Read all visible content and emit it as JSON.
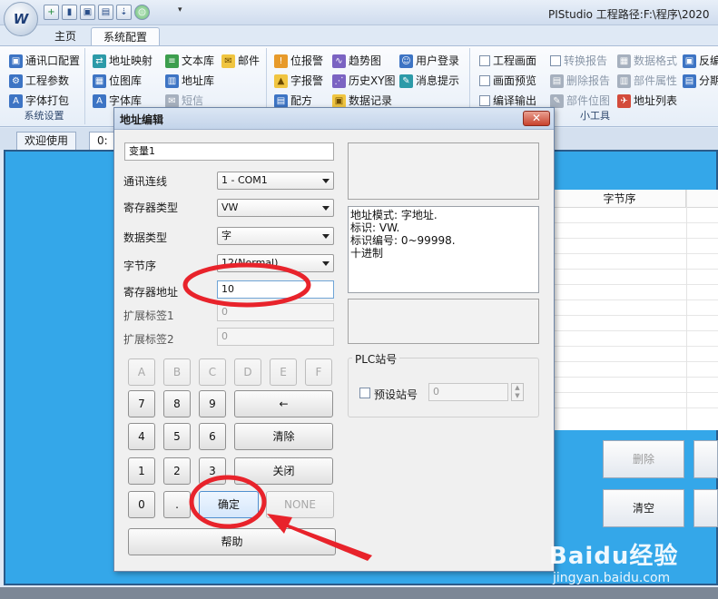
{
  "app": {
    "logo_text": "W",
    "title": "PIStudio   工程路径:F:\\程序\\2020",
    "qat_icons": [
      "add-icon",
      "open-file-icon",
      "save-icon",
      "print-icon",
      "download-icon",
      "refresh-icon"
    ]
  },
  "ribbon_tabs": [
    "主页",
    "系统配置"
  ],
  "ribbon": {
    "groups": [
      {
        "caption": "系统设置",
        "items": [
          "通讯口配置",
          "工程参数",
          "字体打包"
        ]
      },
      {
        "caption": "",
        "items": [
          "地址映射",
          "位图库",
          "字体库",
          "文本库",
          "地址库",
          "短信",
          "邮件"
        ]
      },
      {
        "caption": "",
        "items": [
          "位报警",
          "字报警",
          "配方",
          "趋势图",
          "历史XY图",
          "数据记录",
          "用户登录",
          "消息提示"
        ]
      },
      {
        "caption": "小工具",
        "items": [
          "工程画面",
          "画面预览",
          "编译输出",
          "转换报告",
          "删除报告",
          "部件位图",
          "数据格式",
          "部件属性",
          "地址列表",
          "反编",
          "分期"
        ]
      }
    ]
  },
  "doc_tabs": [
    "欢迎使用",
    "0:"
  ],
  "workspace": {
    "table_header": [
      "字节序"
    ],
    "buttons": {
      "delete": "删除",
      "clear": "清空"
    }
  },
  "dialog": {
    "title": "地址编辑",
    "close_label": "✕",
    "name_value": "变量1",
    "fields": {
      "comm_label": "通讯连线",
      "comm_value": "1 - COM1",
      "reg_type_label": "寄存器类型",
      "reg_type_value": "VW",
      "data_type_label": "数据类型",
      "data_type_value": "字",
      "byte_order_label": "字节序",
      "byte_order_value": "12(Normal)",
      "reg_addr_label": "寄存器地址",
      "reg_addr_value": "10",
      "ext1_label": "扩展标签1",
      "ext1_value": "0",
      "ext2_label": "扩展标签2",
      "ext2_value": "0"
    },
    "info": "地址模式: 字地址.\n标识: VW.\n标识编号: 0~99998.\n十进制",
    "keypad": {
      "hex_keys": [
        "A",
        "B",
        "C",
        "D",
        "E",
        "F"
      ],
      "row1": [
        "7",
        "8",
        "9"
      ],
      "backspace": "←",
      "row2": [
        "4",
        "5",
        "6"
      ],
      "clear": "清除",
      "row3": [
        "1",
        "2",
        "3"
      ],
      "close": "关闭",
      "zero": "0",
      "dot": ".",
      "ok": "确定",
      "none": "NONE",
      "help": "帮助"
    },
    "plc": {
      "group_label": "PLC站号",
      "preset_label": "预设站号",
      "station_value": "0"
    }
  },
  "watermark": {
    "main": "Baidu经验",
    "sub": "jingyan.baidu.com"
  },
  "colors": {
    "workspace_bg": "#34a7e9",
    "annotation": "#e8232b"
  }
}
